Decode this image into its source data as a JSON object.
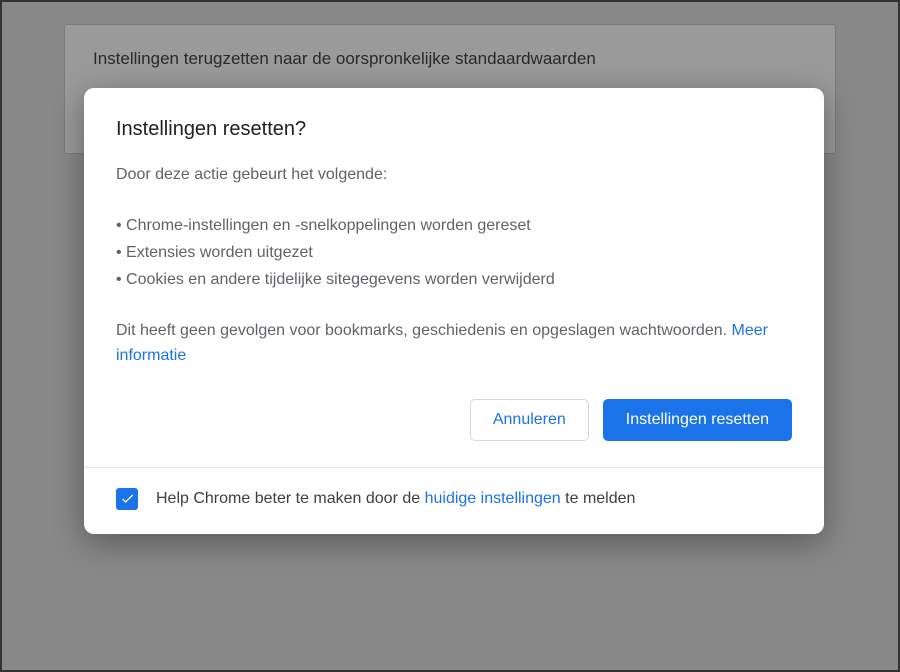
{
  "banner": {
    "text": "Instellingen terugzetten naar de oorspronkelijke standaardwaarden"
  },
  "dialog": {
    "title": "Instellingen resetten?",
    "intro": "Door deze actie gebeurt het volgende:",
    "bullets": [
      "Chrome-instellingen en -snelkoppelingen worden gereset",
      "Extensies worden uitgezet",
      "Cookies en andere tijdelijke sitegegevens worden verwijderd"
    ],
    "note_before": "Dit heeft geen gevolgen voor bookmarks, geschiedenis en opgeslagen wachtwoorden. ",
    "note_link": "Meer informatie",
    "actions": {
      "cancel": "Annuleren",
      "confirm": "Instellingen resetten"
    },
    "footer": {
      "checked": true,
      "text_before": "Help Chrome beter te maken door de ",
      "text_link": "huidige instellingen",
      "text_after": " te melden"
    }
  }
}
